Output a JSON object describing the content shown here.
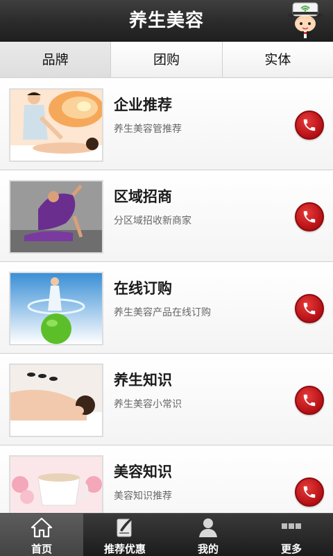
{
  "header": {
    "title": "养生美容",
    "mascot_icon": "mascot-icon"
  },
  "tabs": [
    {
      "label": "品牌",
      "active": true
    },
    {
      "label": "团购",
      "active": false
    },
    {
      "label": "实体",
      "active": false
    }
  ],
  "list": [
    {
      "title": "企业推荐",
      "subtitle": "养生美容管推荐",
      "image": "massage-photo",
      "call_icon": "phone-icon"
    },
    {
      "title": "区域招商",
      "subtitle": "分区域招收新商家",
      "image": "yoga-photo",
      "call_icon": "phone-icon"
    },
    {
      "title": "在线订购",
      "subtitle": "养生美容产品在线订购",
      "image": "apple-splash-photo",
      "call_icon": "phone-icon"
    },
    {
      "title": "养生知识",
      "subtitle": "养生美容小常识",
      "image": "hot-stone-photo",
      "call_icon": "phone-icon"
    },
    {
      "title": "美容知识",
      "subtitle": "美容知识推荐",
      "image": "tea-cup-photo",
      "call_icon": "phone-icon"
    }
  ],
  "bottom_nav": [
    {
      "label": "首页",
      "icon": "home-icon",
      "active": true
    },
    {
      "label": "推荐优惠",
      "icon": "recommend-icon",
      "active": false
    },
    {
      "label": "我的",
      "icon": "user-icon",
      "active": false
    },
    {
      "label": "更多",
      "icon": "more-icon",
      "active": false
    }
  ],
  "colors": {
    "header": "#2c2c2c",
    "call_button": "#c0121a",
    "bottom_bar": "#262626"
  }
}
